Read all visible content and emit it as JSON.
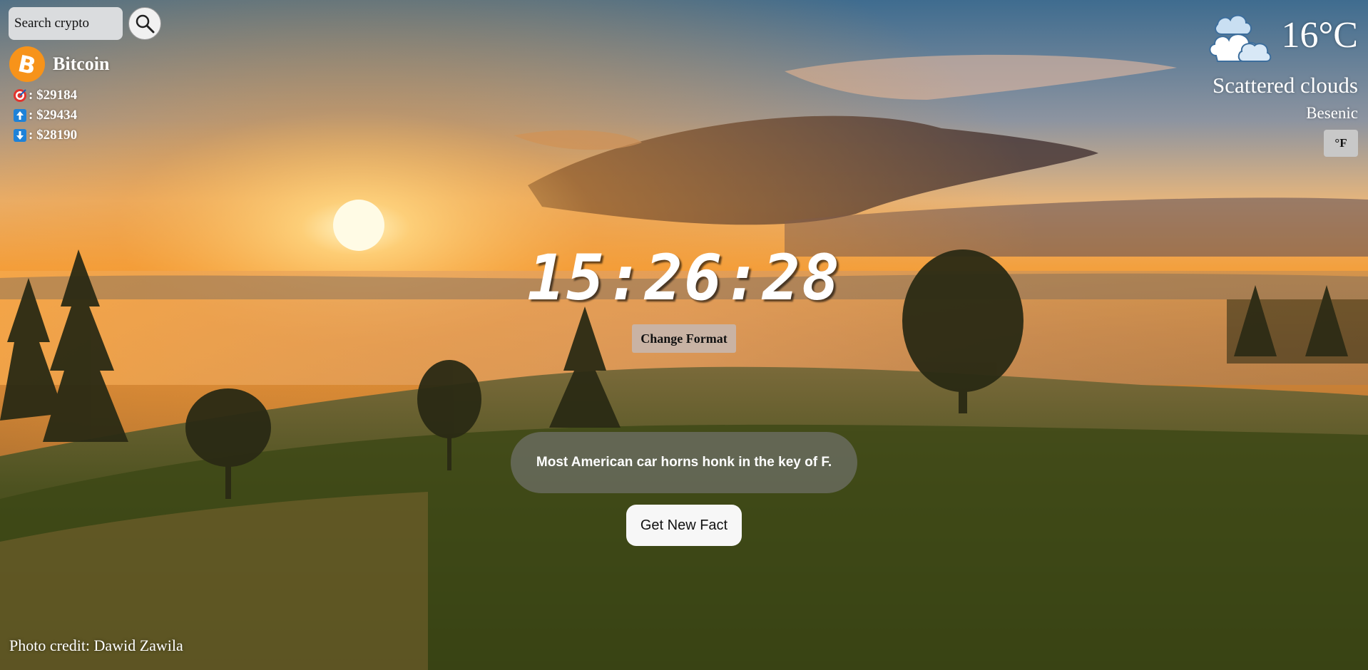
{
  "background": {
    "colors": {
      "sky": "#3f6c8f",
      "sun": "#fff2b0",
      "glow": "#f39a2a",
      "grass": "#3b4616"
    }
  },
  "crypto": {
    "search_placeholder": "Search crypto",
    "search_icon": "search-icon",
    "coin_logo_icon": "bitcoin-icon",
    "coin_name": "Bitcoin",
    "prices": [
      {
        "icon": "target-icon",
        "label": ": $29184"
      },
      {
        "icon": "up-arrow-icon",
        "label": ": $29434"
      },
      {
        "icon": "down-arrow-icon",
        "label": ": $28190"
      }
    ],
    "colors": {
      "bitcoin": "#f7931a",
      "arrow_tile": "#1e82d8",
      "target": "#e2332d"
    }
  },
  "weather": {
    "icon": "clouds-icon",
    "temperature": "16°C",
    "description": "Scattered clouds",
    "location": "Besenic",
    "unit_button": "°F"
  },
  "clock": {
    "time": "15:26:28",
    "format_button": "Change Format"
  },
  "fact": {
    "text": "Most American car horns honk in the key of F.",
    "button": "Get New Fact"
  },
  "credit": "Photo credit: Dawid Zawila"
}
